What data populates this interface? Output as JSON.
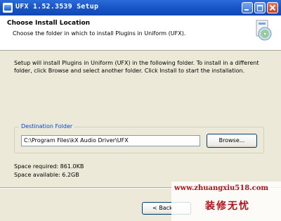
{
  "window": {
    "title": "UFX 1.52.3539 Setup"
  },
  "header": {
    "title": "Choose Install Location",
    "subtitle": "Choose the folder in which to install Plugins in Uniform (UFX)."
  },
  "body": {
    "description": "Setup will install Plugins in Uniform (UFX) in the following folder. To install in a different folder, click Browse and select another folder. Click Install to start the installation.",
    "destination_label": "Destination Folder",
    "destination_path": "C:\\Program Files\\kX Audio Driver\\UFX",
    "browse_label": "Browse...",
    "space_required": "Space required: 861.0KB",
    "space_available": "Space available: 6.2GB"
  },
  "footer": {
    "back_label": "< Back"
  },
  "watermark": {
    "url": "www.zhuangxiu518.com",
    "text": "装修无忧"
  },
  "colors": {
    "titlebar": "#1b56c8",
    "group_label": "#0046d5",
    "watermark": "#b0121b"
  }
}
